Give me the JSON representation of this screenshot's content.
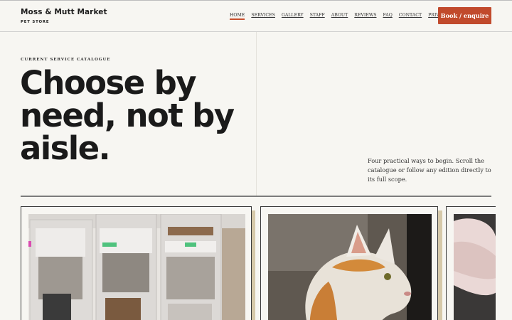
{
  "brand": {
    "name": "Moss & Mutt Market",
    "subtitle": "PET STORE"
  },
  "nav": {
    "items": [
      {
        "label": "HOME",
        "active": true
      },
      {
        "label": "SERVICES"
      },
      {
        "label": "GALLERY"
      },
      {
        "label": "STAFF"
      },
      {
        "label": "ABOUT"
      },
      {
        "label": "REVIEWS"
      },
      {
        "label": "FAQ"
      },
      {
        "label": "CONTACT"
      },
      {
        "label": "PRIVACY"
      }
    ],
    "cta": "Book / enquire"
  },
  "hero": {
    "eyebrow": "CURRENT SERVICE CATALOGUE",
    "headline": "Choose by need, not by aisle.",
    "intro": "Four practical ways to begin. Scroll the catalogue or follow any edition directly to its full scope."
  },
  "colors": {
    "accent": "#c14a2c",
    "background": "#f7f6f2",
    "card_shadow": "#d6c9a9"
  },
  "cards": [
    {
      "image": "pet-food-bulk-bins-photo"
    },
    {
      "image": "orange-white-cat-photo"
    },
    {
      "image": "partial-pet-photo"
    }
  ]
}
